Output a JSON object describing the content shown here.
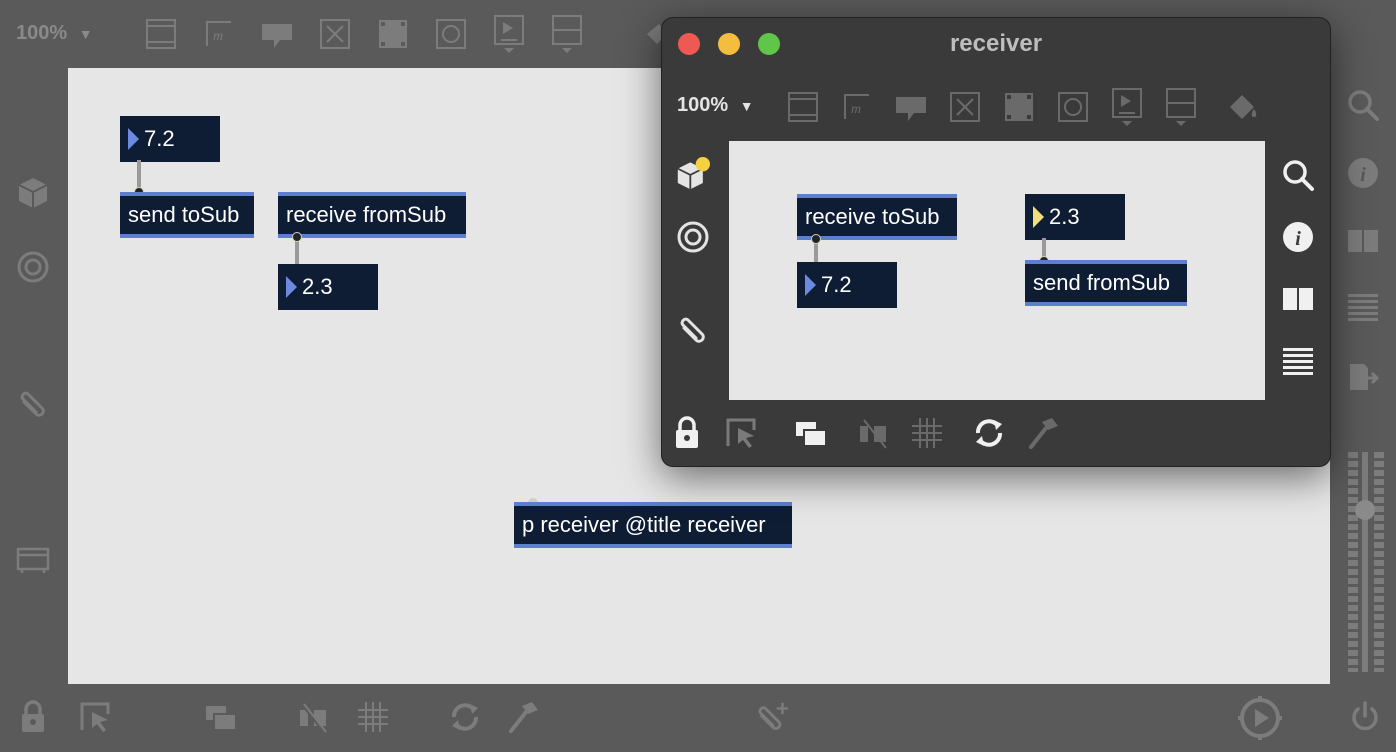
{
  "main_window": {
    "zoom_label": "100%",
    "objects": {
      "number_top": "7.2",
      "send_obj": "send toSub",
      "receive_obj": "receive fromSub",
      "number_bottom": "2.3",
      "subpatcher_obj": "p receiver @title receiver"
    }
  },
  "sub_window": {
    "title": "receiver",
    "zoom_label": "100%",
    "objects": {
      "receive_obj": "receive toSub",
      "number_received": "7.2",
      "number_send": "2.3",
      "send_obj": "send fromSub"
    }
  },
  "colors": {
    "object_bg": "#0e1d33",
    "object_border": "#5b7fce",
    "canvas_bg": "#e6e6e6",
    "toolbar_bg": "#5a5a5a",
    "traffic_red": "#ee5a52",
    "traffic_yellow": "#f5bd3f",
    "traffic_green": "#5fc64a"
  },
  "icons": {
    "top_toolbar": [
      "presentation-icon",
      "message-icon",
      "comment-icon",
      "toggle-icon",
      "button-icon",
      "bang-icon",
      "live-icon",
      "slider-icon",
      "paint-bucket-icon"
    ],
    "left_sidebar": [
      "package-icon",
      "target-icon",
      "paperclip-icon",
      "inspector-tray-icon"
    ],
    "right_sidebar": [
      "search-icon",
      "info-icon",
      "book-icon",
      "list-icon",
      "export-icon"
    ],
    "bottom_toolbar": [
      "lock-icon",
      "arrow-select-icon",
      "present-icon",
      "hide-icon",
      "grid-icon",
      "refresh-icon",
      "debug-hammer-icon",
      "add-paperclip-icon",
      "audio-icon",
      "power-icon"
    ]
  }
}
